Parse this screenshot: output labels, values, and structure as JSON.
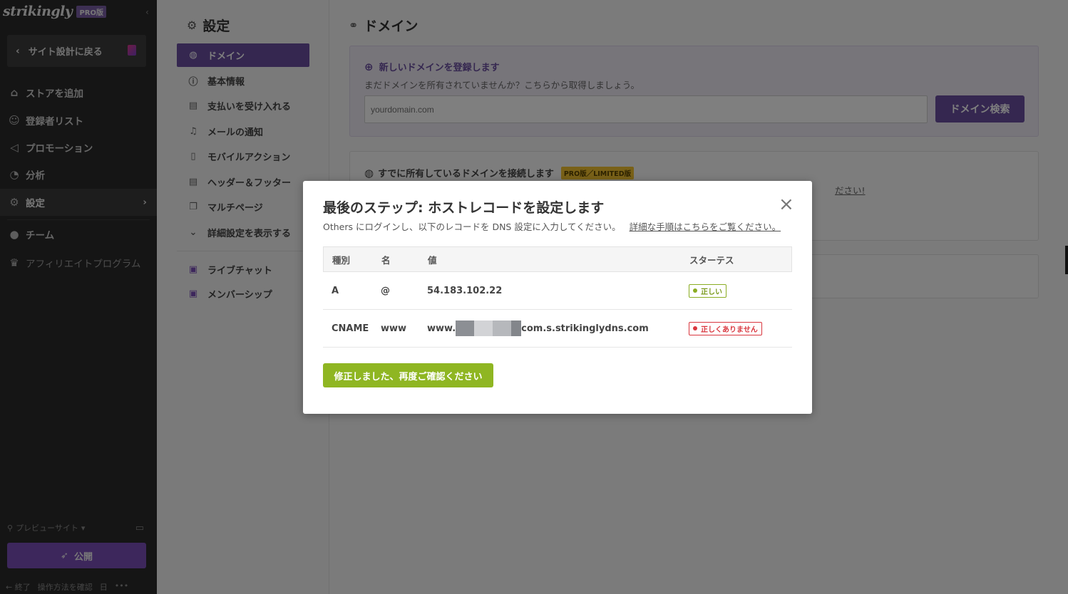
{
  "sidebar": {
    "logo": "strikingly",
    "pro_badge": "PRO版",
    "back_label": "サイト設計に戻る",
    "items": [
      {
        "label": "ストアを追加"
      },
      {
        "label": "登録者リスト"
      },
      {
        "label": "プロモーション"
      },
      {
        "label": "分析"
      },
      {
        "label": "設定"
      },
      {
        "label": "チーム"
      },
      {
        "label": "アフィリエイトプログラム"
      }
    ],
    "preview_label": "プレビューサイト",
    "publish_label": "公開",
    "footer": [
      "終了",
      "操作方法を確認",
      "日",
      "•••"
    ]
  },
  "settings": {
    "title": "設定",
    "items": [
      {
        "label": "ドメイン"
      },
      {
        "label": "基本情報"
      },
      {
        "label": "支払いを受け入れる"
      },
      {
        "label": "メールの通知"
      },
      {
        "label": "モバイルアクション"
      },
      {
        "label": "ヘッダー＆フッター"
      },
      {
        "label": "マルチページ"
      },
      {
        "label": "詳細設定を表示する"
      },
      {
        "label": "ライブチャット"
      },
      {
        "label": "メンバーシップ"
      }
    ]
  },
  "main": {
    "title": "ドメイン",
    "new_domain": {
      "heading": "新しいドメインを登録します",
      "sub": "まだドメインを所有されていませんか？こちらから取得しましょう。",
      "placeholder": "yourdomain.com",
      "button": "ドメイン検索"
    },
    "own_domain": {
      "heading": "すでに所有しているドメインを接続します",
      "tag": "PRO版／LIMITED版",
      "hint": "ださい!"
    }
  },
  "modal": {
    "title": "最後のステップ: ホストレコードを設定します",
    "sub": "Others にログインし、以下のレコードを DNS 設定に入力してください。",
    "sub_link": "詳細な手順はこちらをご覧ください。",
    "columns": [
      "種別",
      "名",
      "値",
      "スターテス"
    ],
    "rows": [
      {
        "type": "A",
        "name": "@",
        "value_prefix": "54.183.102.22",
        "value_suffix": "",
        "status": "正しい"
      },
      {
        "type": "CNAME",
        "name": "www",
        "value_prefix": "www.",
        "value_suffix": "com.s.strikinglydns.com",
        "status": "正しくありません"
      }
    ],
    "button": "修正しました、再度ご確認ください"
  }
}
